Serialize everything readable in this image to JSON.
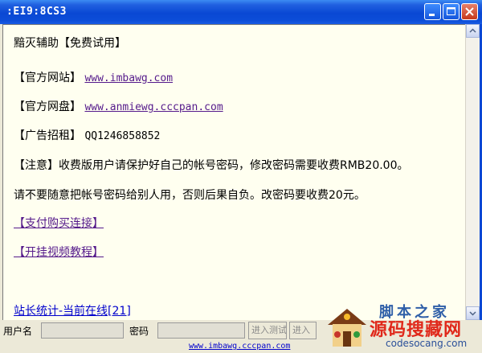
{
  "window": {
    "title": ":EI9:8CS3"
  },
  "content": {
    "heading": "黯灭辅助【免费试用】",
    "official_site_label": "【官方网站】",
    "official_site_url": "www.imbawg.com",
    "official_disk_label": "【官方网盘】",
    "official_disk_url": "www.anmiewg.cccpan.com",
    "ad_label": "【广告招租】",
    "ad_value": "QQ1246858852",
    "notice_line1": "【注意】收费版用户请保护好自己的帐号密码，修改密码需要收费RMB20.00。",
    "notice_line2": "请不要随意把帐号密码给别人用，否则后果自负。改密码要收费20元。",
    "pay_link": "【支付购买连接】",
    "video_link": "【开挂视频教程】",
    "stats_link": "站长统计-当前在线[21]"
  },
  "login": {
    "username_label": "用户名",
    "username_value": "",
    "password_label": "密码",
    "password_value": "",
    "enter_test_button": "进入测试",
    "enter_button": "进入"
  },
  "footer": {
    "link": "www.imbawg.cccpan.com"
  },
  "watermark": {
    "line1": "脚本之家",
    "line2": "源码搜藏网",
    "line3": "codesocang.com"
  },
  "colors": {
    "titlebar": "#0a48d4",
    "content_bg": "#fffff0",
    "link_purple": "#551a8b",
    "link_blue": "#0000cc",
    "watermark_red": "#e0281a"
  }
}
